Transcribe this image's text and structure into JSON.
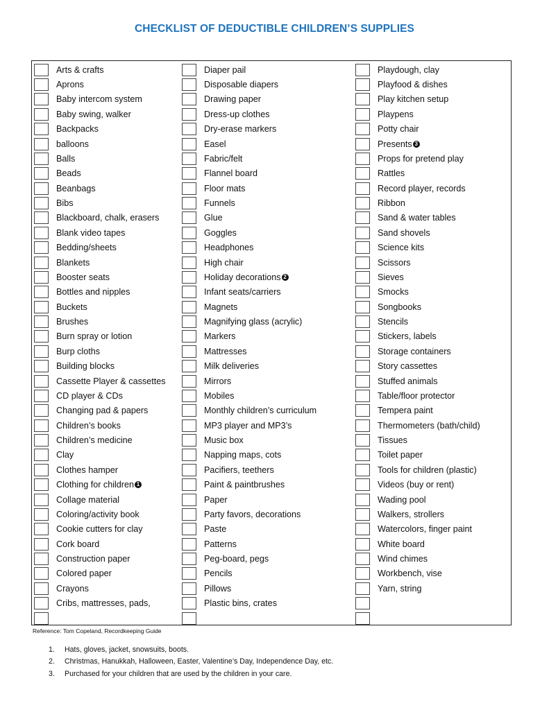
{
  "title": "CHECKLIST OF DEDUCTIBLE CHILDREN’S SUPPLIES",
  "title_color": "#1e73be",
  "columns": [
    {
      "items": [
        {
          "label": "Arts & crafts",
          "note": null,
          "checked": false
        },
        {
          "label": "Aprons",
          "note": null,
          "checked": false
        },
        {
          "label": "Baby intercom system",
          "note": null,
          "checked": false
        },
        {
          "label": "Baby swing, walker",
          "note": null,
          "checked": false
        },
        {
          "label": "Backpacks",
          "note": null,
          "checked": false
        },
        {
          "label": "balloons",
          "note": null,
          "checked": false
        },
        {
          "label": "Balls",
          "note": null,
          "checked": false
        },
        {
          "label": "Beads",
          "note": null,
          "checked": false
        },
        {
          "label": "Beanbags",
          "note": null,
          "checked": false
        },
        {
          "label": "Bibs",
          "note": null,
          "checked": false
        },
        {
          "label": "Blackboard, chalk, erasers",
          "note": null,
          "checked": false
        },
        {
          "label": "Blank video tapes",
          "note": null,
          "checked": false
        },
        {
          "label": "Bedding/sheets",
          "note": null,
          "checked": false
        },
        {
          "label": "Blankets",
          "note": null,
          "checked": false
        },
        {
          "label": "Booster seats",
          "note": null,
          "checked": false
        },
        {
          "label": "Bottles and nipples",
          "note": null,
          "checked": false
        },
        {
          "label": "Buckets",
          "note": null,
          "checked": false
        },
        {
          "label": "Brushes",
          "note": null,
          "checked": false
        },
        {
          "label": "Burn spray or lotion",
          "note": null,
          "checked": false
        },
        {
          "label": "Burp cloths",
          "note": null,
          "checked": false
        },
        {
          "label": "Building blocks",
          "note": null,
          "checked": false
        },
        {
          "label": "Cassette Player & cassettes",
          "note": null,
          "checked": false
        },
        {
          "label": "CD player & CDs",
          "note": null,
          "checked": false
        },
        {
          "label": "Changing pad & papers",
          "note": null,
          "checked": false
        },
        {
          "label": "Children’s books",
          "note": null,
          "checked": false
        },
        {
          "label": "Children’s medicine",
          "note": null,
          "checked": false
        },
        {
          "label": "Clay",
          "note": null,
          "checked": false
        },
        {
          "label": "Clothes hamper",
          "note": null,
          "checked": false
        },
        {
          "label": "Clothing for children",
          "note": "1",
          "checked": false
        },
        {
          "label": "Collage material",
          "note": null,
          "checked": false
        },
        {
          "label": "Coloring/activity book",
          "note": null,
          "checked": false
        },
        {
          "label": "Cookie cutters for clay",
          "note": null,
          "checked": false
        },
        {
          "label": "Cork board",
          "note": null,
          "checked": false
        },
        {
          "label": "Construction paper",
          "note": null,
          "checked": false
        },
        {
          "label": "Colored paper",
          "note": null,
          "checked": false
        },
        {
          "label": "Crayons",
          "note": null,
          "checked": false
        },
        {
          "label": "Cribs, mattresses, pads,",
          "note": null,
          "checked": false
        },
        {
          "label": "",
          "note": null,
          "checked": false
        }
      ]
    },
    {
      "items": [
        {
          "label": "Diaper pail",
          "note": null,
          "checked": false
        },
        {
          "label": "Disposable diapers",
          "note": null,
          "checked": false
        },
        {
          "label": "Drawing paper",
          "note": null,
          "checked": false
        },
        {
          "label": "Dress-up clothes",
          "note": null,
          "checked": false
        },
        {
          "label": "Dry-erase markers",
          "note": null,
          "checked": false
        },
        {
          "label": "Easel",
          "note": null,
          "checked": false
        },
        {
          "label": "Fabric/felt",
          "note": null,
          "checked": false
        },
        {
          "label": "Flannel board",
          "note": null,
          "checked": false
        },
        {
          "label": "Floor mats",
          "note": null,
          "checked": false
        },
        {
          "label": "Funnels",
          "note": null,
          "checked": false
        },
        {
          "label": "Glue",
          "note": null,
          "checked": false
        },
        {
          "label": "Goggles",
          "note": null,
          "checked": false
        },
        {
          "label": "Headphones",
          "note": null,
          "checked": false
        },
        {
          "label": "High chair",
          "note": null,
          "checked": false
        },
        {
          "label": "Holiday decorations",
          "note": "2",
          "checked": false
        },
        {
          "label": "Infant seats/carriers",
          "note": null,
          "checked": false
        },
        {
          "label": "Magnets",
          "note": null,
          "checked": false
        },
        {
          "label": "Magnifying glass (acrylic)",
          "note": null,
          "checked": false
        },
        {
          "label": "Markers",
          "note": null,
          "checked": false
        },
        {
          "label": "Mattresses",
          "note": null,
          "checked": false
        },
        {
          "label": "Milk deliveries",
          "note": null,
          "checked": false
        },
        {
          "label": "Mirrors",
          "note": null,
          "checked": false
        },
        {
          "label": "Mobiles",
          "note": null,
          "checked": false
        },
        {
          "label": "Monthly children’s curriculum",
          "note": null,
          "checked": false
        },
        {
          "label": "MP3 player and MP3’s",
          "note": null,
          "checked": false
        },
        {
          "label": "Music box",
          "note": null,
          "checked": false
        },
        {
          "label": "Napping maps, cots",
          "note": null,
          "checked": false
        },
        {
          "label": "Pacifiers, teethers",
          "note": null,
          "checked": false
        },
        {
          "label": "Paint & paintbrushes",
          "note": null,
          "checked": false
        },
        {
          "label": "Paper",
          "note": null,
          "checked": false
        },
        {
          "label": "Party favors, decorations",
          "note": null,
          "checked": false
        },
        {
          "label": "Paste",
          "note": null,
          "checked": false
        },
        {
          "label": "Patterns",
          "note": null,
          "checked": false
        },
        {
          "label": "Peg-board, pegs",
          "note": null,
          "checked": false
        },
        {
          "label": "Pencils",
          "note": null,
          "checked": false
        },
        {
          "label": "Pillows",
          "note": null,
          "checked": false
        },
        {
          "label": "Plastic bins, crates",
          "note": null,
          "checked": false
        },
        {
          "label": "",
          "note": null,
          "checked": false
        }
      ]
    },
    {
      "items": [
        {
          "label": "Playdough, clay",
          "note": null,
          "checked": false
        },
        {
          "label": "Playfood & dishes",
          "note": null,
          "checked": false
        },
        {
          "label": "Play kitchen setup",
          "note": null,
          "checked": false
        },
        {
          "label": "Playpens",
          "note": null,
          "checked": false
        },
        {
          "label": "Potty chair",
          "note": null,
          "checked": false
        },
        {
          "label": "Presents",
          "note": "3",
          "checked": false
        },
        {
          "label": "Props for pretend play",
          "note": null,
          "checked": false
        },
        {
          "label": "Rattles",
          "note": null,
          "checked": false
        },
        {
          "label": "Record player, records",
          "note": null,
          "checked": false
        },
        {
          "label": "Ribbon",
          "note": null,
          "checked": false
        },
        {
          "label": "Sand & water tables",
          "note": null,
          "checked": false
        },
        {
          "label": "Sand shovels",
          "note": null,
          "checked": false
        },
        {
          "label": "Science kits",
          "note": null,
          "checked": false
        },
        {
          "label": "Scissors",
          "note": null,
          "checked": false
        },
        {
          "label": "Sieves",
          "note": null,
          "checked": false
        },
        {
          "label": "Smocks",
          "note": null,
          "checked": false
        },
        {
          "label": "Songbooks",
          "note": null,
          "checked": false
        },
        {
          "label": "Stencils",
          "note": null,
          "checked": false
        },
        {
          "label": "Stickers, labels",
          "note": null,
          "checked": false
        },
        {
          "label": "Storage containers",
          "note": null,
          "checked": false
        },
        {
          "label": "Story cassettes",
          "note": null,
          "checked": false
        },
        {
          "label": "Stuffed animals",
          "note": null,
          "checked": false
        },
        {
          "label": "Table/floor protector",
          "note": null,
          "checked": false
        },
        {
          "label": "Tempera paint",
          "note": null,
          "checked": false
        },
        {
          "label": "Thermometers (bath/child)",
          "note": null,
          "checked": false
        },
        {
          "label": "Tissues",
          "note": null,
          "checked": false
        },
        {
          "label": "Toilet paper",
          "note": null,
          "checked": false
        },
        {
          "label": "Tools for children (plastic)",
          "note": null,
          "checked": false
        },
        {
          "label": "Videos (buy or rent)",
          "note": null,
          "checked": false
        },
        {
          "label": "Wading pool",
          "note": null,
          "checked": false
        },
        {
          "label": "Walkers, strollers",
          "note": null,
          "checked": false
        },
        {
          "label": "Watercolors, finger paint",
          "note": null,
          "checked": false
        },
        {
          "label": "White board",
          "note": null,
          "checked": false
        },
        {
          "label": "Wind chimes",
          "note": null,
          "checked": false
        },
        {
          "label": "Workbench, vise",
          "note": null,
          "checked": false
        },
        {
          "label": "Yarn, string",
          "note": null,
          "checked": false
        },
        {
          "label": "",
          "note": null,
          "checked": false
        },
        {
          "label": "",
          "note": null,
          "checked": false
        }
      ]
    }
  ],
  "reference": "Reference: Tom Copeland, Recordkeeping Guide",
  "footnotes": [
    {
      "num": "1.",
      "text": "Hats, gloves, jacket, snowsuits, boots."
    },
    {
      "num": "2.",
      "text": "Christmas, Hanukkah, Halloween, Easter, Valentine’s Day, Independence Day, etc."
    },
    {
      "num": "3.",
      "text": "Purchased for your children that are used by the children in your care."
    }
  ]
}
